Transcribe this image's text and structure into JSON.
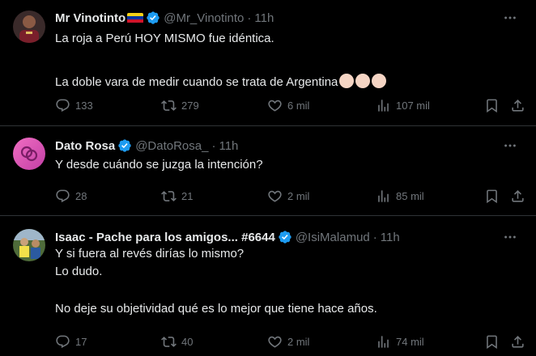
{
  "tweets": [
    {
      "name": "Mr Vinotinto",
      "handle": "@Mr_Vinotinto",
      "separator": "·",
      "time": "11h",
      "lines": [
        "La roja a Perú HOY MISMO fue idéntica.",
        "",
        "La doble vara de medir cuando se trata de Argentina"
      ],
      "emoji": [
        "clapping-hands",
        "clapping-hands",
        "clapping-hands"
      ],
      "replies": "133",
      "reposts": "279",
      "likes": "6 mil",
      "views": "107 mil"
    },
    {
      "name": "Dato Rosa",
      "handle": "@DatoRosa_",
      "separator": "·",
      "time": "11h",
      "lines": [
        "Y desde cuándo se juzga la intención?"
      ],
      "replies": "28",
      "reposts": "21",
      "likes": "2 mil",
      "views": "85 mil"
    },
    {
      "name": "Isaac - Pache para los amigos... #6644",
      "handle": "@IsiMalamud",
      "separator": "·",
      "time": "11h",
      "lines": [
        "Y si fuera al revés dirías lo mismo?",
        "Lo dudo.",
        "",
        "No deje su objetividad qué es lo mejor que tiene hace años."
      ],
      "replies": "17",
      "reposts": "40",
      "likes": "2 mil",
      "views": "74 mil"
    }
  ],
  "colors": {
    "verified": "#1d9bf0",
    "muted": "#71767b",
    "divider": "#2f3336",
    "background": "#000000"
  }
}
